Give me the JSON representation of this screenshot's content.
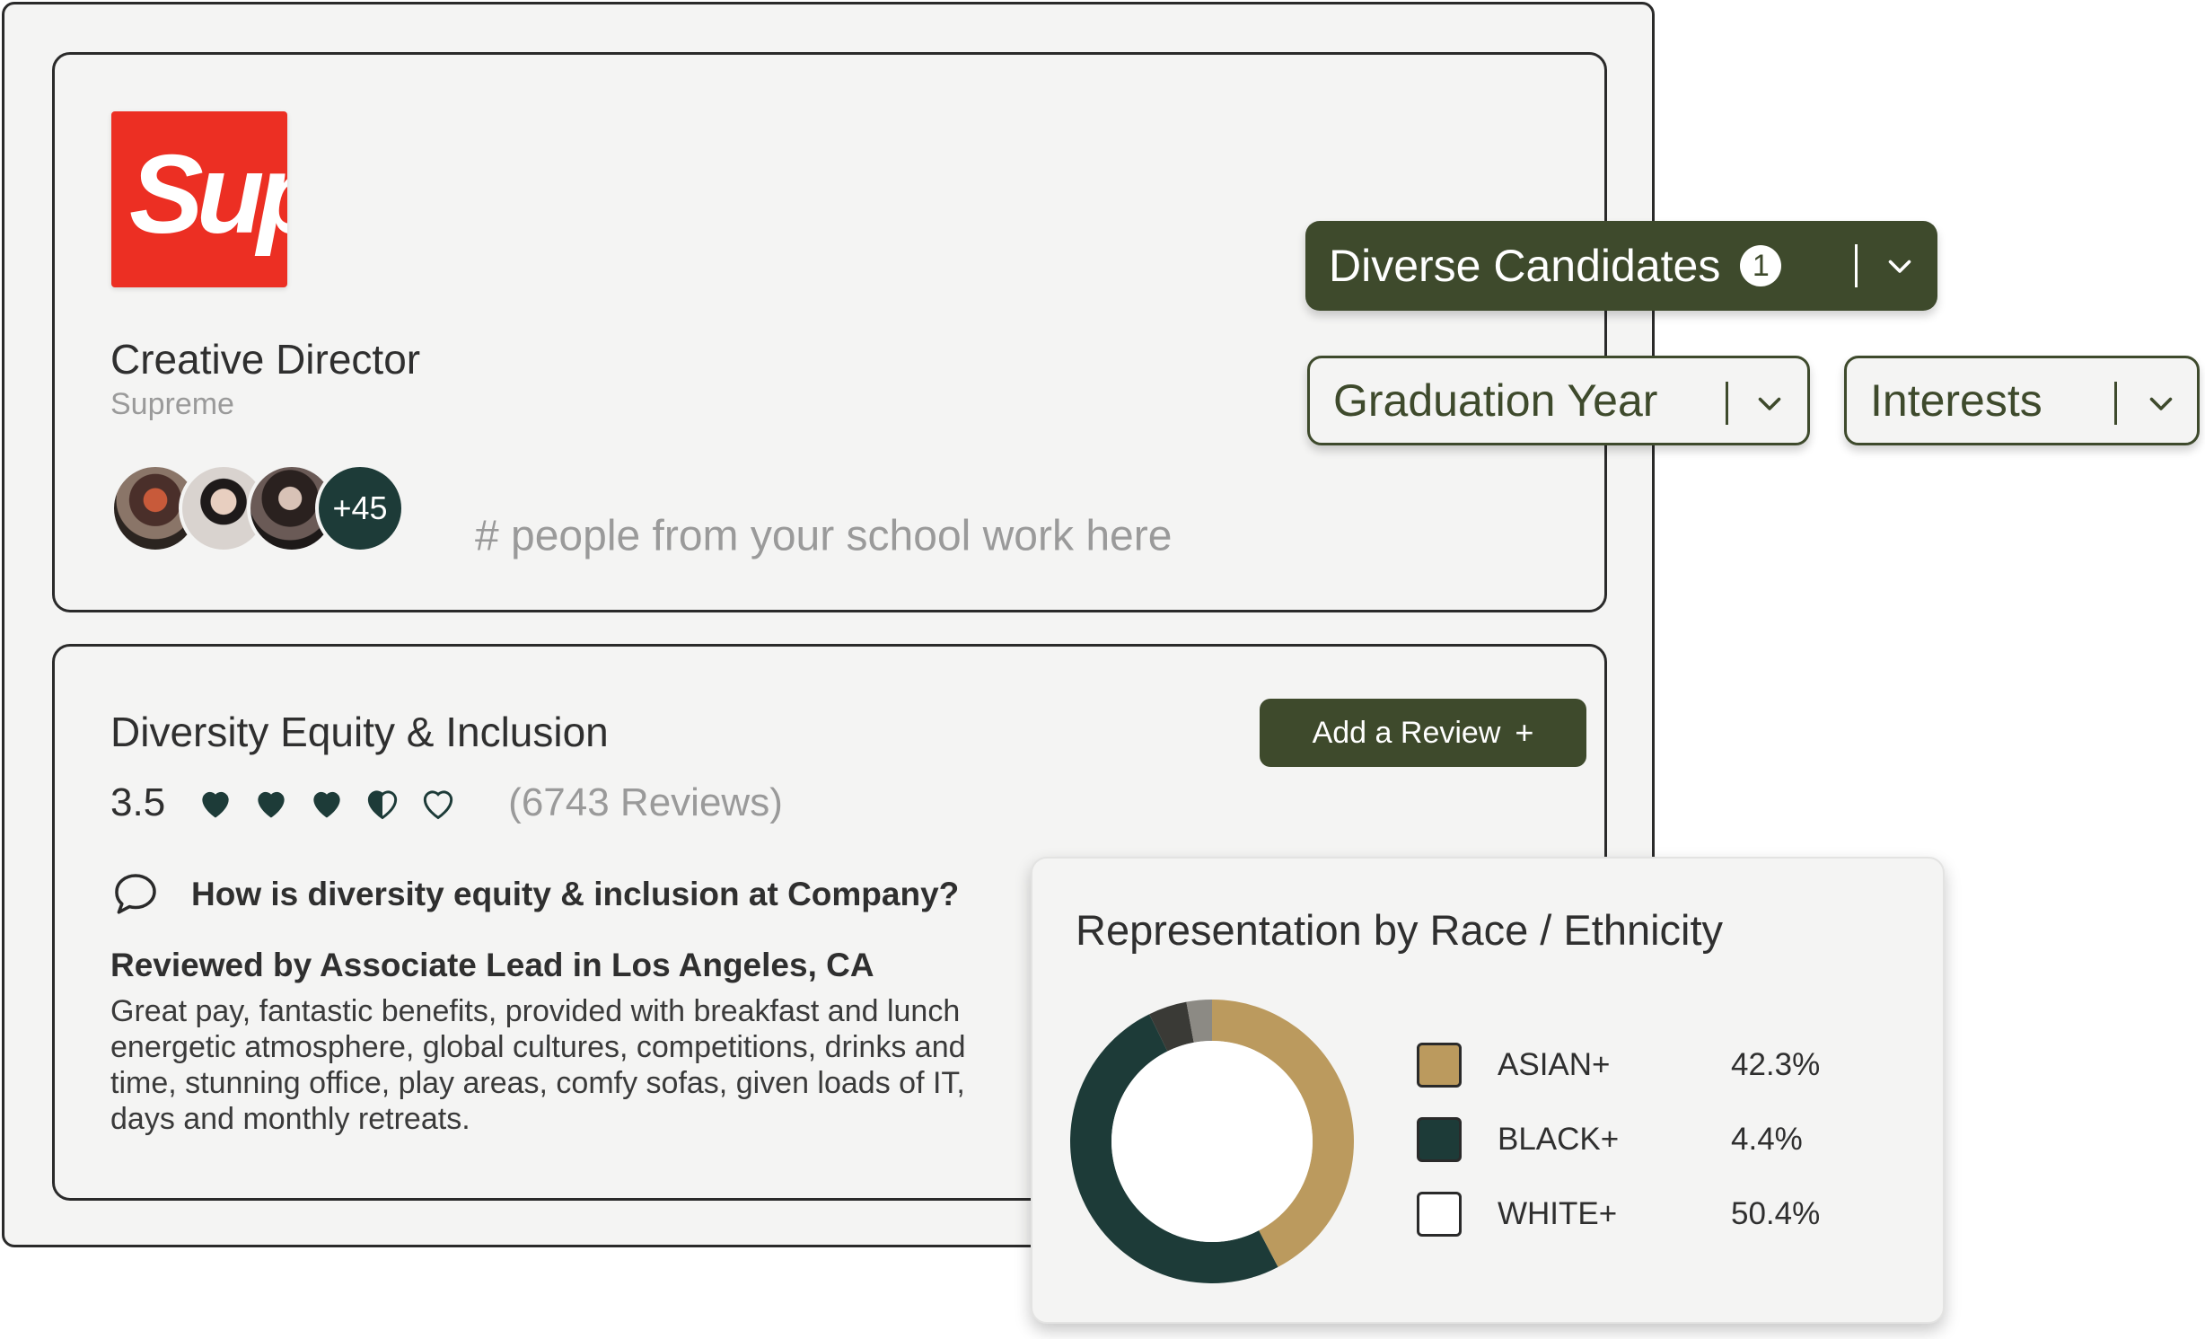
{
  "company_logo": {
    "text": "Sup",
    "color": "#ec2f23"
  },
  "job": {
    "title": "Creative Director",
    "company": "Supreme"
  },
  "people": {
    "count_badge": "+45",
    "text": "# people from your school work here"
  },
  "dei": {
    "title": "Diversity Equity & Inclusion",
    "rating": "3.5",
    "rating_value": 3.5,
    "rating_max": 5,
    "reviews": "(6743 Reviews)",
    "add_review_label": "Add a Review",
    "add_review_icon": "+",
    "question": "How is diversity equity & inclusion at Company?",
    "reviewer": "Reviewed by Associate Lead in Los Angeles, CA",
    "review_text": "Great pay, fantastic benefits, provided with breakfast and lunch\nenergetic atmosphere, global cultures, competitions, drinks and\ntime, stunning office, play areas, comfy sofas, given loads of IT,\ndays and monthly retreats."
  },
  "filters": {
    "diverse_candidates": {
      "label": "Diverse Candidates",
      "badge": "1"
    },
    "graduation_year": {
      "label": "Graduation Year"
    },
    "interests": {
      "label": "Interests"
    }
  },
  "colors": {
    "accent": "#3e4a2c",
    "dark_teal": "#1d3b38",
    "tan": "#bb9a5e",
    "muted": "#9a9a9a"
  },
  "chart_data": {
    "type": "pie",
    "title": "Representation by Race / Ethnicity",
    "series": [
      {
        "name": "ASIAN+",
        "value": 42.3,
        "label": "42.3%",
        "color": "#bb9a5e"
      },
      {
        "name": "BLACK+",
        "value": 4.4,
        "label": "4.4%",
        "color": "#1d3b38"
      },
      {
        "name": "WHITE+",
        "value": 50.4,
        "label": "50.4%",
        "color": "#ffffff"
      }
    ],
    "donut_segments": [
      {
        "value": 42.3,
        "color": "#bb9a5e"
      },
      {
        "value": 50.4,
        "color": "#1d3b38"
      },
      {
        "value": 4.4,
        "color": "#3a3a36"
      },
      {
        "value": 2.9,
        "color": "#8c8a84"
      }
    ]
  }
}
